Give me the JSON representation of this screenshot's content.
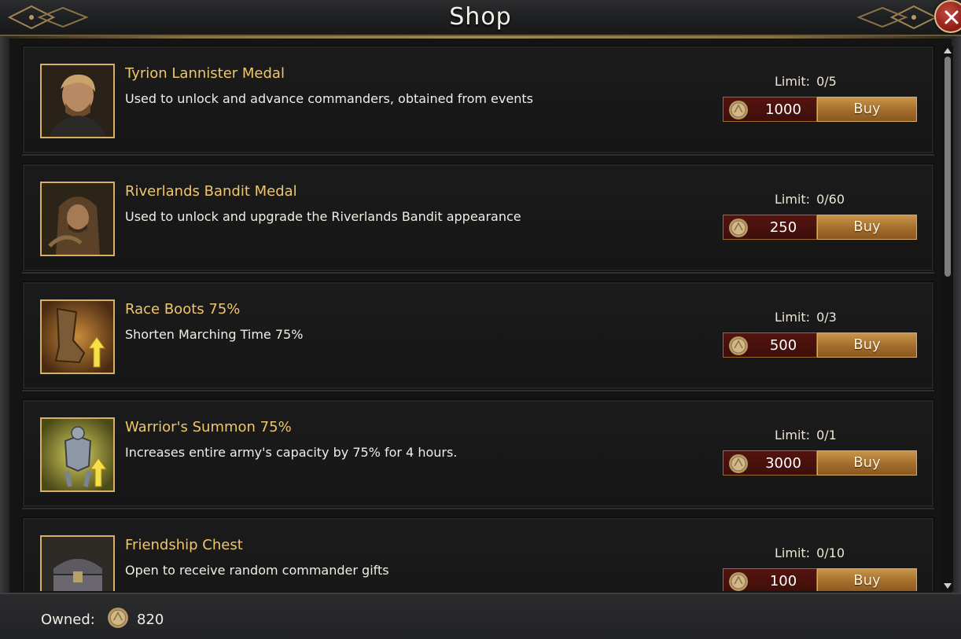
{
  "window": {
    "title": "Shop"
  },
  "items": [
    {
      "name": "Tyrion Lannister Medal",
      "description": "Used to unlock and advance commanders, obtained from events",
      "limit_label": "Limit:",
      "limit_value": "0/5",
      "price": "1000",
      "buy_label": "Buy",
      "icon": "tyrion-portrait-icon"
    },
    {
      "name": "Riverlands Bandit Medal",
      "description": "Used to unlock and upgrade the Riverlands Bandit appearance",
      "limit_label": "Limit:",
      "limit_value": "0/60",
      "price": "250",
      "buy_label": "Buy",
      "icon": "bandit-portrait-icon"
    },
    {
      "name": "Race Boots 75%",
      "description": "Shorten Marching Time 75%",
      "limit_label": "Limit:",
      "limit_value": "0/3",
      "price": "500",
      "buy_label": "Buy",
      "icon": "boots-icon"
    },
    {
      "name": "Warrior's Summon 75%",
      "description": "Increases entire army's capacity by 75% for 4 hours.",
      "limit_label": "Limit:",
      "limit_value": "0/1",
      "price": "3000",
      "buy_label": "Buy",
      "icon": "armor-icon"
    },
    {
      "name": "Friendship Chest",
      "description": "Open to receive random commander gifts",
      "limit_label": "Limit:",
      "limit_value": "0/10",
      "price": "100",
      "buy_label": "Buy",
      "icon": "chest-icon"
    }
  ],
  "footer": {
    "owned_label": "Owned:",
    "owned_value": "820",
    "currency_icon": "coin-icon"
  },
  "colors": {
    "item_name": "#f0c66a",
    "buy_button": "#b07a35",
    "price_bg": "#4a110d",
    "icon_border": "#d7b062"
  }
}
